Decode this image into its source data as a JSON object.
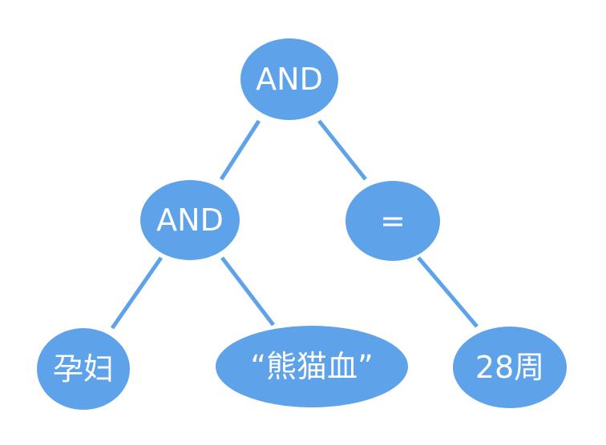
{
  "diagram": {
    "colors": {
      "node_fill": "#5ea3ea",
      "edge": "#5ea3ea",
      "label_text": "#ffffff",
      "background": "#ffffff"
    },
    "nodes": {
      "root": {
        "label": "AND"
      },
      "left_and": {
        "label": "AND"
      },
      "equals": {
        "label": "="
      },
      "pregnant": {
        "label": "孕妇"
      },
      "panda_blood": {
        "label": "“熊猫血”"
      },
      "weeks": {
        "label": "28周"
      }
    },
    "edges": [
      {
        "from": "root",
        "to": "left_and"
      },
      {
        "from": "root",
        "to": "equals"
      },
      {
        "from": "left_and",
        "to": "pregnant"
      },
      {
        "from": "left_and",
        "to": "panda_blood"
      },
      {
        "from": "equals",
        "to": "weeks"
      }
    ]
  }
}
